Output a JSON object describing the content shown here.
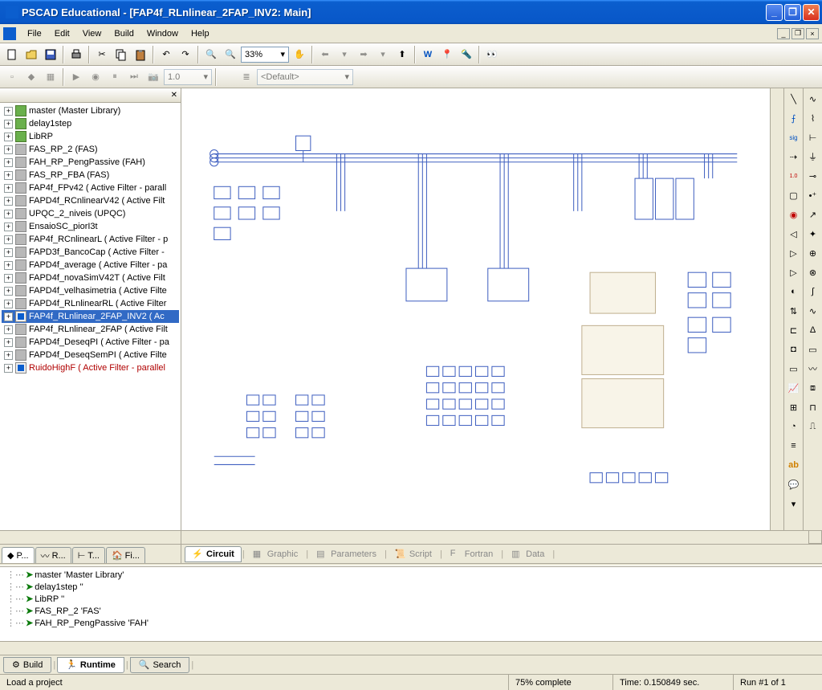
{
  "title": "PSCAD Educational - [FAP4f_RLnlinear_2FAP_INV2: Main]",
  "menu": {
    "file": "File",
    "edit": "Edit",
    "view": "View",
    "build": "Build",
    "window": "Window",
    "help": "Help"
  },
  "zoom": "33%",
  "layer_combo": "<Default>",
  "toolbar2_value": "1.0",
  "tree": [
    {
      "label": "master (Master Library)",
      "icon": "green"
    },
    {
      "label": "delay1step",
      "icon": "green"
    },
    {
      "label": "LibRP",
      "icon": "green"
    },
    {
      "label": "FAS_RP_2 (FAS)",
      "icon": "gray"
    },
    {
      "label": "FAH_RP_PengPassive (FAH)",
      "icon": "gray"
    },
    {
      "label": "FAS_RP_FBA (FAS)",
      "icon": "gray"
    },
    {
      "label": "FAP4f_FPv42 ( Active Filter - parall",
      "icon": "gray"
    },
    {
      "label": "FAPD4f_RCnlinearV42 ( Active Filt",
      "icon": "gray"
    },
    {
      "label": "UPQC_2_niveis (UPQC)",
      "icon": "gray"
    },
    {
      "label": "EnsaioSC_piorI3t",
      "icon": "gray"
    },
    {
      "label": "FAP4f_RCnlinearL ( Active Filter - p",
      "icon": "gray"
    },
    {
      "label": "FAPD3f_BancoCap ( Active Filter -",
      "icon": "gray"
    },
    {
      "label": "FAPD4f_average ( Active Filter - pa",
      "icon": "gray"
    },
    {
      "label": "FAPD4f_novaSimV42T ( Active Filt",
      "icon": "gray"
    },
    {
      "label": "FAPD4f_velhasimetria ( Active Filte",
      "icon": "gray"
    },
    {
      "label": "FAPD4f_RLnlinearRL ( Active Filter",
      "icon": "gray"
    },
    {
      "label": "FAP4f_RLnlinear_2FAP_INV2 ( Ac",
      "icon": "blue",
      "selected": true
    },
    {
      "label": "FAP4f_RLnlinear_2FAP ( Active Filt",
      "icon": "gray"
    },
    {
      "label": "FAPD4f_DeseqPI ( Active Filter - pa",
      "icon": "gray"
    },
    {
      "label": "FAPD4f_DeseqSemPI ( Active Filte",
      "icon": "gray"
    },
    {
      "label": "RuidoHighF ( Active Filter - parallel",
      "icon": "blue",
      "red": true
    }
  ],
  "left_tabs": [
    {
      "label": "P...",
      "active": true
    },
    {
      "label": "R..."
    },
    {
      "label": "T..."
    },
    {
      "label": "Fi..."
    }
  ],
  "canvas_tabs": [
    {
      "label": "Circuit",
      "active": true
    },
    {
      "label": "Graphic"
    },
    {
      "label": "Parameters"
    },
    {
      "label": "Script"
    },
    {
      "label": "Fortran"
    },
    {
      "label": "Data"
    }
  ],
  "bottom_tree": [
    "master 'Master Library'",
    "delay1step ''",
    "LibRP ''",
    "FAS_RP_2 'FAS'",
    "FAH_RP_PengPassive 'FAH'"
  ],
  "bottom_tabs": [
    {
      "label": "Build"
    },
    {
      "label": "Runtime",
      "active": true
    },
    {
      "label": "Search"
    }
  ],
  "status": {
    "left": "Load a project",
    "complete": "75% complete",
    "time": "Time: 0.150849 sec.",
    "run": "Run #1 of 1"
  }
}
